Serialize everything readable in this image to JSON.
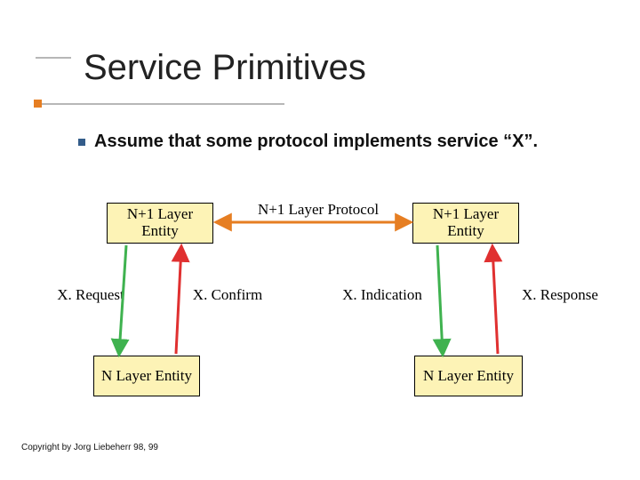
{
  "slide": {
    "title": "Service Primitives",
    "bullet_text": "Assume that some protocol implements service “X”.",
    "copyright": "Copyright by Jorg Liebeherr 98, 99"
  },
  "diagram": {
    "box_upper_left": "N+1 Layer Entity",
    "box_upper_right": "N+1 Layer Entity",
    "box_lower_left": "N  Layer Entity",
    "box_lower_right": "N  Layer Entity",
    "protocol_label": "N+1 Layer Protocol",
    "label_request": "X. Request",
    "label_confirm": "X. Confirm",
    "label_indication": "X. Indication",
    "label_response": "X. Response"
  }
}
